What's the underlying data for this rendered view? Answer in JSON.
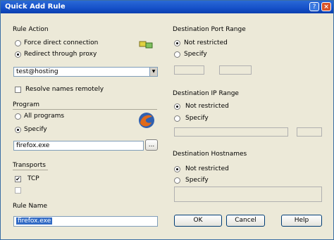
{
  "window": {
    "title": "Quick Add Rule",
    "help_glyph": "?",
    "close_glyph": "×"
  },
  "rule_action": {
    "legend": "Rule Action",
    "option_direct": "Force direct connection",
    "option_proxy": "Redirect through proxy",
    "selected": "option_proxy",
    "proxy_value": "test@hosting",
    "resolve_label": "Resolve names remotely",
    "resolve_checked": false
  },
  "program": {
    "legend": "Program",
    "option_all": "All programs",
    "option_specify": "Specify",
    "selected": "option_specify",
    "path_value": "firefox.exe",
    "browse_label": "..."
  },
  "transports": {
    "legend": "Transports",
    "tcp_label": "TCP",
    "tcp_checked": true,
    "udp_label": "",
    "udp_checked": false,
    "check_mark": "✔"
  },
  "rule_name": {
    "legend": "Rule Name",
    "value": "firefox.exe"
  },
  "dest_port_range": {
    "legend": "Destination Port Range",
    "option_unrestricted": "Not restricted",
    "option_specify": "Specify",
    "selected": "option_unrestricted",
    "from": "",
    "to": ""
  },
  "dest_ip_range": {
    "legend": "Destination IP Range",
    "option_unrestricted": "Not restricted",
    "option_specify": "Specify",
    "selected": "option_unrestricted",
    "from": "",
    "to": ""
  },
  "dest_hostnames": {
    "legend": "Destination Hostnames",
    "option_unrestricted": "Not restricted",
    "option_specify": "Specify",
    "selected": "option_unrestricted",
    "value": ""
  },
  "buttons": {
    "ok": "OK",
    "cancel": "Cancel",
    "help": "Help"
  },
  "colors": {
    "title_bar": "#1550c8",
    "dialog_bg": "#ece9d8",
    "selection": "#316ac5"
  }
}
